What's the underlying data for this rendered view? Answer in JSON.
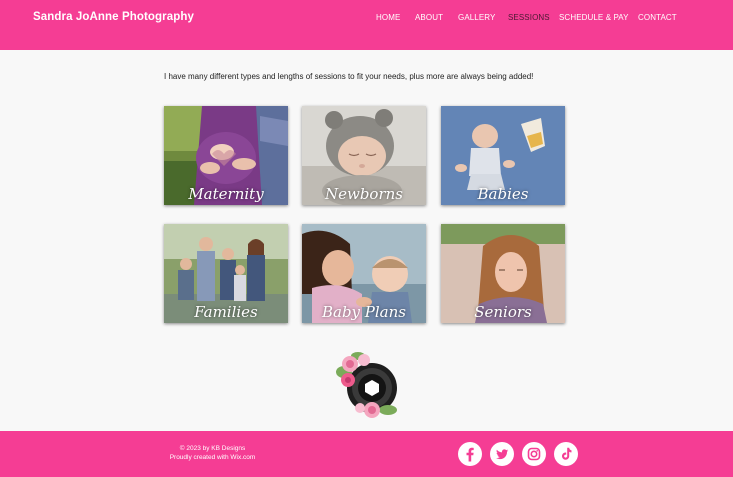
{
  "header": {
    "title": "Sandra JoAnne Photography",
    "nav": [
      {
        "label": "HOME",
        "active": false
      },
      {
        "label": "ABOUT",
        "active": false
      },
      {
        "label": "GALLERY",
        "active": false
      },
      {
        "label": "SESSIONS",
        "active": true
      },
      {
        "label": "SCHEDULE & PAY",
        "active": false
      },
      {
        "label": "CONTACT",
        "active": false
      }
    ]
  },
  "main": {
    "intro": "I have many different types and lengths of sessions to  fit your needs, plus more are always being added!",
    "sessions": [
      {
        "label": "Maternity"
      },
      {
        "label": "Newborns"
      },
      {
        "label": "Babies"
      },
      {
        "label": "Families"
      },
      {
        "label": "Baby Plans"
      },
      {
        "label": "Seniors"
      }
    ]
  },
  "footer": {
    "copyright": "© 2023 by KB Designs",
    "credit": "Proudly created with Wix.com",
    "social": [
      {
        "icon": "facebook-icon"
      },
      {
        "icon": "twitter-icon"
      },
      {
        "icon": "instagram-icon"
      },
      {
        "icon": "tiktok-icon"
      }
    ]
  },
  "colors": {
    "brand_pink": "#f53d94",
    "nav_active": "#4a1a33",
    "page_bg": "#f8f8f8"
  }
}
